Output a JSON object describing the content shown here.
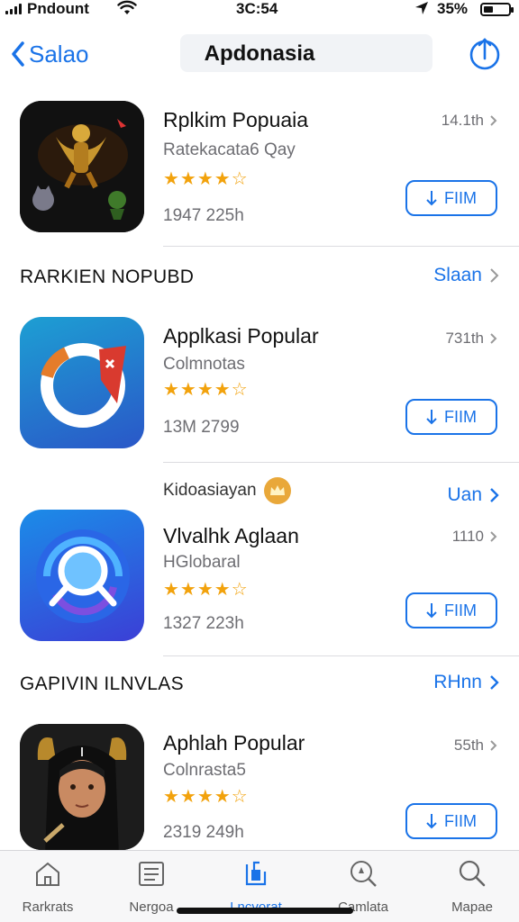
{
  "status_bar": {
    "carrier": "Pndount",
    "time": "3C:54",
    "battery": "35%",
    "battery_level": 0.35
  },
  "nav": {
    "back_label": "Salao",
    "title": "Apdonasia",
    "share_icon": "share-icon"
  },
  "featured": {
    "name": "Rplkim Popuaia",
    "subtitle": "Ratekacata6 Qay",
    "rating": 4.5,
    "meta": "1947 225h",
    "size": "14.1th",
    "button_label": "FIIM"
  },
  "section1": {
    "title": "RARKIEN NOPUBD",
    "link": "Slaan",
    "apps": [
      {
        "name": "Applkasi Popular",
        "subtitle": "Colmnotas",
        "rating": 4.5,
        "meta": "13M 2799",
        "size": "731th",
        "button_label": "FIIM"
      }
    ],
    "promo": {
      "label": "Kidoasiayan",
      "link": "Uan"
    },
    "promo_app": {
      "name": "Vlvalhk Aglaan",
      "subtitle": "HGlobaral",
      "rating": 4.5,
      "meta": "1327 223h",
      "size": "1110",
      "button_label": "FIIM"
    }
  },
  "section2": {
    "title": "GAPIVIN ILNVLAS",
    "link": "RHnn",
    "apps": [
      {
        "name": "Aphlah Popular",
        "subtitle": "Colnrasta5",
        "rating": 4.5,
        "meta": "2319 249h",
        "size": "55th",
        "button_label": "FIIM"
      }
    ]
  },
  "tab_bar": {
    "items": [
      {
        "label": "Rarkrats",
        "icon": "home-icon"
      },
      {
        "label": "Nergoa",
        "icon": "list-icon"
      },
      {
        "label": "Lncvorat",
        "icon": "apps-icon",
        "active": true
      },
      {
        "label": "Camlata",
        "icon": "compass-icon"
      },
      {
        "label": "Mapae",
        "icon": "search-icon"
      }
    ]
  },
  "colors": {
    "accent": "#1a73e8",
    "star": "#f2a20c",
    "secondary_text": "#6d6d72"
  }
}
